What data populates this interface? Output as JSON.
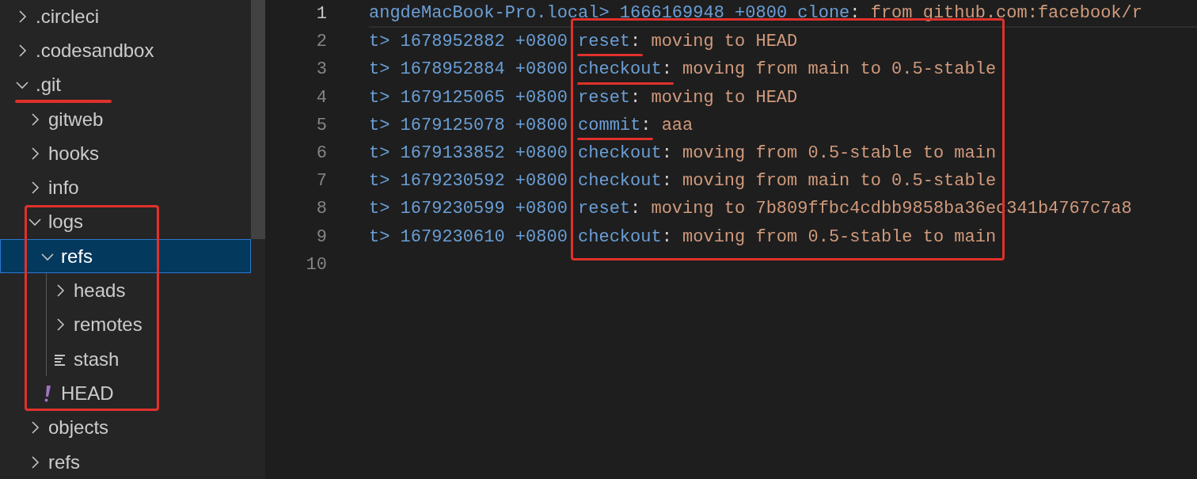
{
  "sidebar": {
    "items": [
      {
        "label": ".circleci",
        "kind": "folder",
        "expanded": false,
        "selected": false
      },
      {
        "label": ".codesandbox",
        "kind": "folder",
        "expanded": false,
        "selected": false
      },
      {
        "label": ".git",
        "kind": "folder",
        "expanded": true,
        "selected": false,
        "underlined": true,
        "children": [
          {
            "label": "gitweb",
            "kind": "folder",
            "expanded": false,
            "selected": false
          },
          {
            "label": "hooks",
            "kind": "folder",
            "expanded": false,
            "selected": false
          },
          {
            "label": "info",
            "kind": "folder",
            "expanded": false,
            "selected": false
          },
          {
            "label": "logs",
            "kind": "folder",
            "expanded": true,
            "selected": false,
            "boxed": true,
            "children": [
              {
                "label": "refs",
                "kind": "folder",
                "expanded": true,
                "selected": true,
                "children": [
                  {
                    "label": "heads",
                    "kind": "folder",
                    "expanded": false,
                    "selected": false
                  },
                  {
                    "label": "remotes",
                    "kind": "folder",
                    "expanded": false,
                    "selected": false
                  },
                  {
                    "label": "stash",
                    "kind": "text-file",
                    "selected": false
                  }
                ]
              },
              {
                "label": "HEAD",
                "kind": "alert-file",
                "selected": false
              }
            ]
          },
          {
            "label": "objects",
            "kind": "folder",
            "expanded": false,
            "selected": false
          },
          {
            "label": "refs",
            "kind": "folder",
            "expanded": false,
            "selected": false
          }
        ]
      }
    ]
  },
  "editor": {
    "lines": [
      {
        "number": "1",
        "prefix": "angdeMacBook-Pro.local> 1666169948 +0800",
        "action": "clone",
        "separator": ":",
        "message": "from github.com:facebook/r",
        "current": true,
        "underlined": false,
        "boxed": false
      },
      {
        "number": "2",
        "prefix": "t> 1678952882 +0800",
        "action": "reset",
        "separator": ":",
        "message": "moving to HEAD",
        "current": false,
        "underlined": true,
        "boxed": true
      },
      {
        "number": "3",
        "prefix": "t> 1678952884 +0800",
        "action": "checkout",
        "separator": ":",
        "message": "moving from main to 0.5-stable",
        "current": false,
        "underlined": true,
        "boxed": true
      },
      {
        "number": "4",
        "prefix": "t> 1679125065 +0800",
        "action": "reset",
        "separator": ":",
        "message": "moving to HEAD",
        "current": false,
        "underlined": false,
        "boxed": true
      },
      {
        "number": "5",
        "prefix": "t> 1679125078 +0800",
        "action": "commit",
        "separator": ":",
        "message": "aaa",
        "current": false,
        "underlined": true,
        "boxed": true
      },
      {
        "number": "6",
        "prefix": "t> 1679133852 +0800",
        "action": "checkout",
        "separator": ":",
        "message": "moving from 0.5-stable to main",
        "current": false,
        "underlined": false,
        "boxed": true
      },
      {
        "number": "7",
        "prefix": "t> 1679230592 +0800",
        "action": "checkout",
        "separator": ":",
        "message": "moving from main to 0.5-stable",
        "current": false,
        "underlined": false,
        "boxed": true
      },
      {
        "number": "8",
        "prefix": "t> 1679230599 +0800",
        "action": "reset",
        "separator": ":",
        "message": "moving to 7b809ffbc4cdbb9858ba36ec341b4767c7a8",
        "current": false,
        "underlined": false,
        "boxed": true
      },
      {
        "number": "9",
        "prefix": "t> 1679230610 +0800",
        "action": "checkout",
        "separator": ":",
        "message": "moving from 0.5-stable to main",
        "current": false,
        "underlined": false,
        "boxed": true
      },
      {
        "number": "10",
        "current": false,
        "underlined": false,
        "boxed": false
      }
    ]
  }
}
